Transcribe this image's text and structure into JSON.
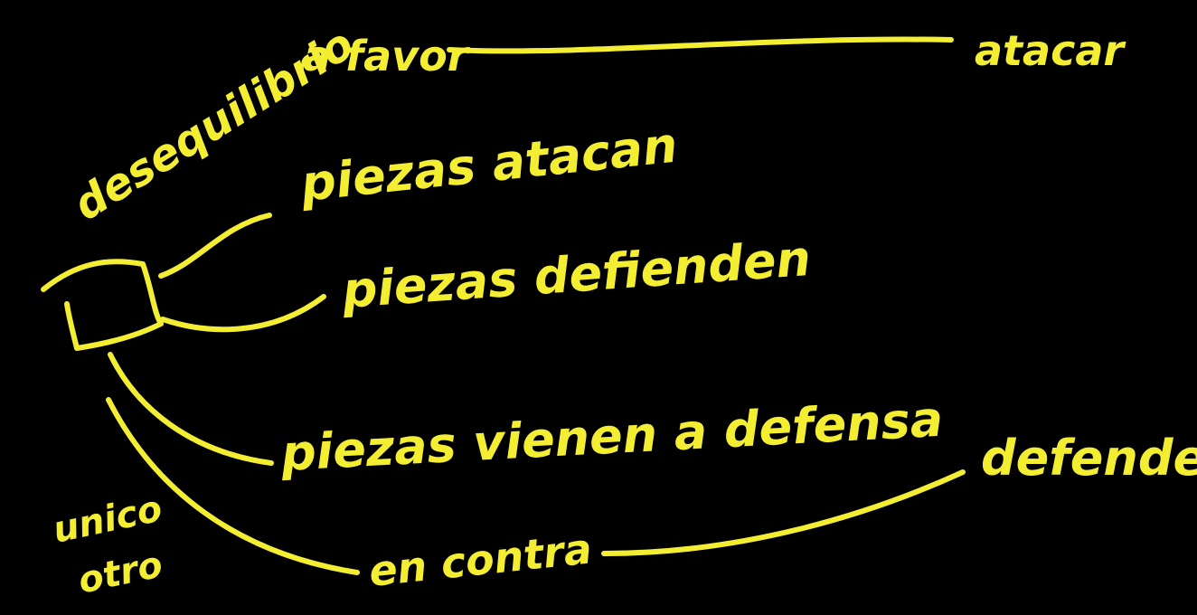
{
  "ink_color": "#f4ee32",
  "background": "#000000",
  "labels": {
    "desequilibrio": "desequilibrio",
    "a_favor": "a favor",
    "atacar": "atacar",
    "piezas_atacan": "piezas atacan",
    "piezas_defienden": "piezas defienden",
    "piezas_vienen_a_defensa": "piezas vienen a defensa",
    "defender": "defender",
    "en_contra": "en contra",
    "unico_otro_1": "unico",
    "unico_otro_2": "otro"
  }
}
